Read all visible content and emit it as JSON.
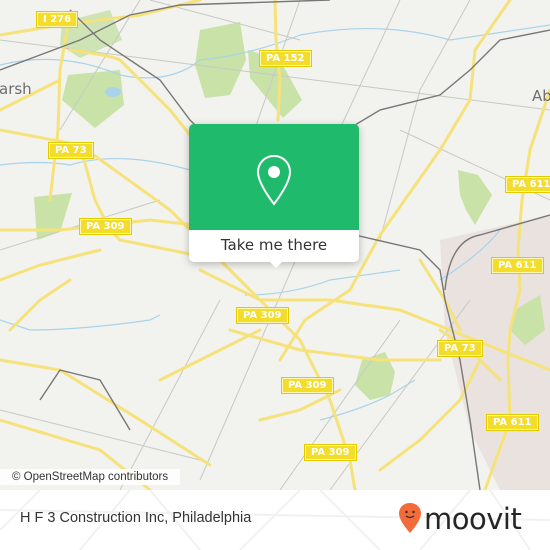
{
  "map": {
    "attribution": "© OpenStreetMap contributors",
    "place_labels": [
      {
        "name": "place-marsh",
        "text": "arsh"
      },
      {
        "name": "place-abington",
        "text": "Ab"
      }
    ],
    "road_shields": [
      {
        "name": "shield-i276",
        "text": "I 276"
      },
      {
        "name": "shield-pa152",
        "text": "PA 152"
      },
      {
        "name": "shield-pa73-west",
        "text": "PA 73"
      },
      {
        "name": "shield-pa309-west",
        "text": "PA 309"
      },
      {
        "name": "shield-pa611-north",
        "text": "PA 611"
      },
      {
        "name": "shield-pa611-mid",
        "text": "PA 611"
      },
      {
        "name": "shield-pa309-center",
        "text": "PA 309"
      },
      {
        "name": "shield-pa73-east",
        "text": "PA 73"
      },
      {
        "name": "shield-pa309-south",
        "text": "PA 309"
      },
      {
        "name": "shield-pa611-south",
        "text": "PA 611"
      },
      {
        "name": "shield-pa309-bottom",
        "text": "PA 309"
      },
      {
        "name": "shield-pa611-bottom",
        "text": "PA 611"
      }
    ],
    "colors": {
      "land": "#f2f2ee",
      "park": "#c8e2a8",
      "road_major": "#f6e27a",
      "water": "#a9d3ea",
      "rail": "#777777",
      "urban": "#e8e0dc"
    }
  },
  "popup": {
    "button_label": "Take me there",
    "accent_color": "#1fba6c",
    "icon": "location-pin-icon"
  },
  "footer": {
    "title": "H F 3 Construction Inc, Philadelphia",
    "logo_text": "moovit",
    "logo_color": "#f26b3a"
  }
}
